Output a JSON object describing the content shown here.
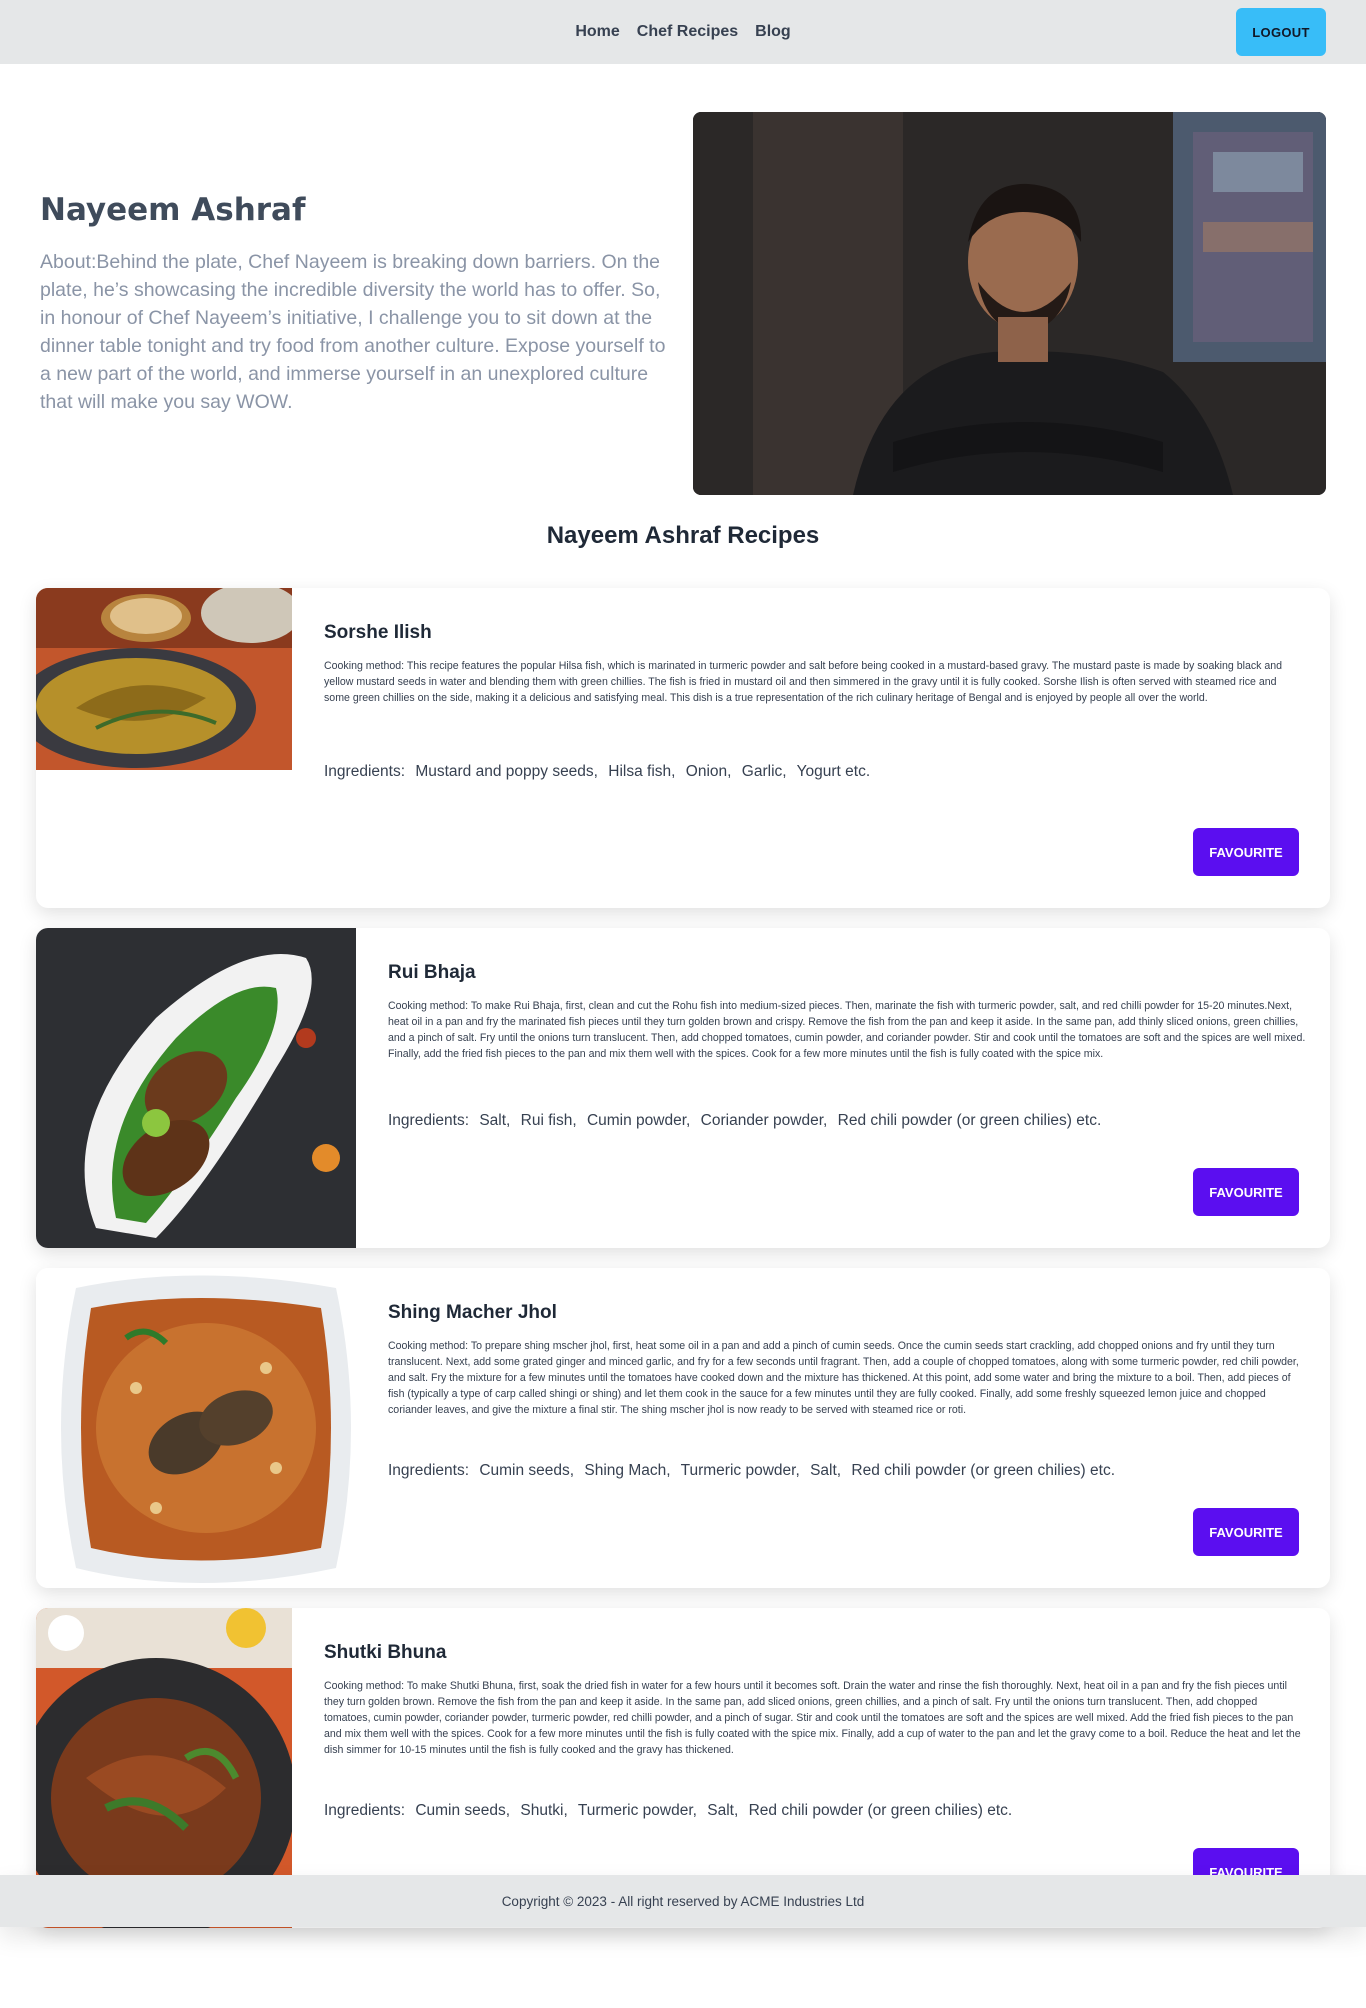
{
  "navbar": {
    "links": [
      "Home",
      "Chef Recipes",
      "Blog"
    ],
    "logout_label": "LOGOUT"
  },
  "chef": {
    "name": "Nayeem Ashraf",
    "about": "About:Behind the plate, Chef Nayeem is breaking down barriers. On the plate, he’s showcasing the incredible diversity the world has to offer. So, in honour of Chef Nayeem’s initiative, I challenge you to sit down at the dinner table tonight and try food from another culture. Expose yourself to a new part of the world, and immerse yourself in an unexplored culture that will make you say WOW."
  },
  "section_title": "Nayeem Ashraf Recipes",
  "recipes": [
    {
      "title": "Sorshe Ilish",
      "method": "Cooking method: This recipe features the popular Hilsa fish, which is marinated in turmeric powder and salt before being cooked in a mustard-based gravy. The mustard paste is made by soaking black and yellow mustard seeds in water and blending them with green chillies. The fish is fried in mustard oil and then simmered in the gravy until it is fully cooked. Sorshe Ilish is often served with steamed rice and some green chillies on the side, making it a delicious and satisfying meal. This dish is a true representation of the rich culinary heritage of Bengal and is enjoyed by people all over the world.",
      "ingredients_label": "Ingredients:",
      "ingredients": [
        "Mustard and poppy seeds,",
        "Hilsa fish,",
        "Onion,",
        "Garlic,",
        "Yogurt etc."
      ],
      "button_label": "FAVOURITE"
    },
    {
      "title": "Rui Bhaja",
      "method": "Cooking method: To make Rui Bhaja, first, clean and cut the Rohu fish into medium-sized pieces. Then, marinate the fish with turmeric powder, salt, and red chilli powder for 15-20 minutes.Next, heat oil in a pan and fry the marinated fish pieces until they turn golden brown and crispy. Remove the fish from the pan and keep it aside. In the same pan, add thinly sliced onions, green chillies, and a pinch of salt. Fry until the onions turn translucent. Then, add chopped tomatoes, cumin powder, and coriander powder. Stir and cook until the tomatoes are soft and the spices are well mixed. Finally, add the fried fish pieces to the pan and mix them well with the spices. Cook for a few more minutes until the fish is fully coated with the spice mix.",
      "ingredients_label": "Ingredients:",
      "ingredients": [
        "Salt,",
        "Rui fish,",
        "Cumin powder,",
        "Coriander powder,",
        "Red chili powder (or green chilies) etc."
      ],
      "button_label": "FAVOURITE"
    },
    {
      "title": "Shing Macher Jhol",
      "method": "Cooking method: To prepare shing mscher jhol, first, heat some oil in a pan and add a pinch of cumin seeds. Once the cumin seeds start crackling, add chopped onions and fry until they turn translucent. Next, add some grated ginger and minced garlic, and fry for a few seconds until fragrant. Then, add a couple of chopped tomatoes, along with some turmeric powder, red chili powder, and salt. Fry the mixture for a few minutes until the tomatoes have cooked down and the mixture has thickened. At this point, add some water and bring the mixture to a boil. Then, add pieces of fish (typically a type of carp called shingi or shing) and let them cook in the sauce for a few minutes until they are fully cooked. Finally, add some freshly squeezed lemon juice and chopped coriander leaves, and give the mixture a final stir. The shing mscher jhol is now ready to be served with steamed rice or roti.",
      "ingredients_label": "Ingredients:",
      "ingredients": [
        "Cumin seeds,",
        "Shing Mach,",
        "Turmeric powder,",
        "Salt,",
        "Red chili powder (or green chilies) etc."
      ],
      "button_label": "FAVOURITE"
    },
    {
      "title": "Shutki Bhuna",
      "method": "Cooking method: To make Shutki Bhuna, first, soak the dried fish in water for a few hours until it becomes soft. Drain the water and rinse the fish thoroughly. Next, heat oil in a pan and fry the fish pieces until they turn golden brown. Remove the fish from the pan and keep it aside. In the same pan, add sliced onions, green chillies, and a pinch of salt. Fry until the onions turn translucent. Then, add chopped tomatoes, cumin powder, coriander powder, turmeric powder, red chilli powder, and a pinch of sugar. Stir and cook until the tomatoes are soft and the spices are well mixed. Add the fried fish pieces to the pan and mix them well with the spices. Cook for a few more minutes until the fish is fully coated with the spice mix. Finally, add a cup of water to the pan and let the gravy come to a boil. Reduce the heat and let the dish simmer for 10-15 minutes until the fish is fully cooked and the gravy has thickened.",
      "ingredients_label": "Ingredients:",
      "ingredients": [
        "Cumin seeds,",
        "Shutki,",
        "Turmeric powder,",
        "Salt,",
        "Red chili powder (or green chilies) etc."
      ],
      "button_label": "FAVOURITE"
    }
  ],
  "footer": {
    "text": "Copyright © 2023 - All right reserved by ACME Industries Ltd"
  }
}
